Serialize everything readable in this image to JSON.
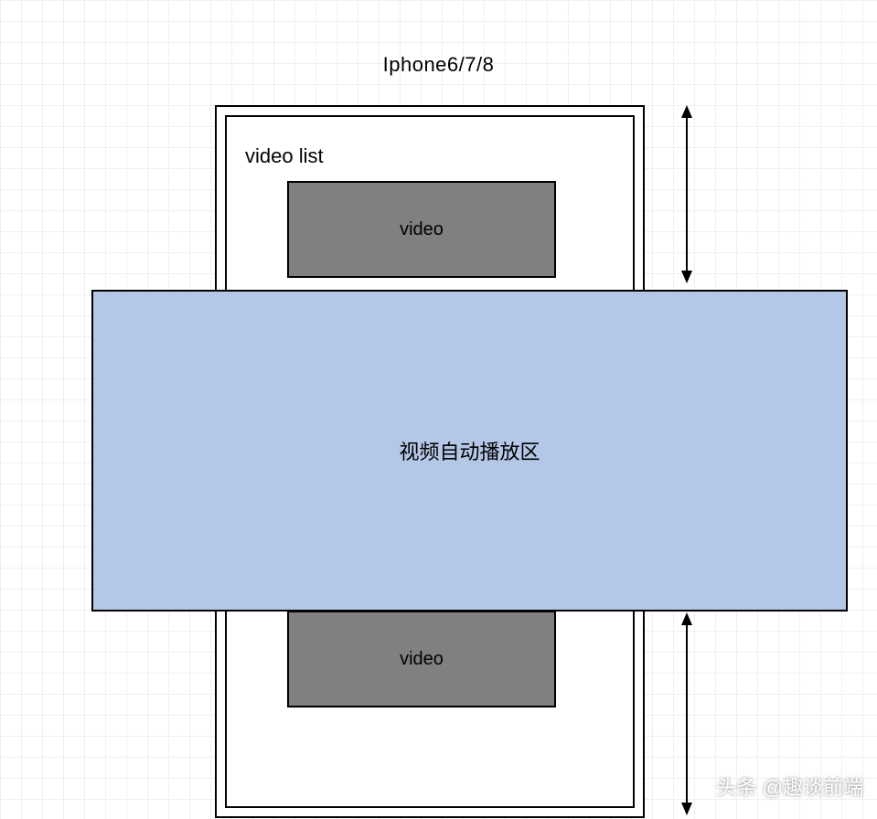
{
  "title": "Iphone6/7/8",
  "videoListLabel": "video list",
  "videoLabel1": "video",
  "videoLabel2": "video",
  "autoplayLabel": "视频自动播放区",
  "watermark": "头条 @趣谈前端"
}
